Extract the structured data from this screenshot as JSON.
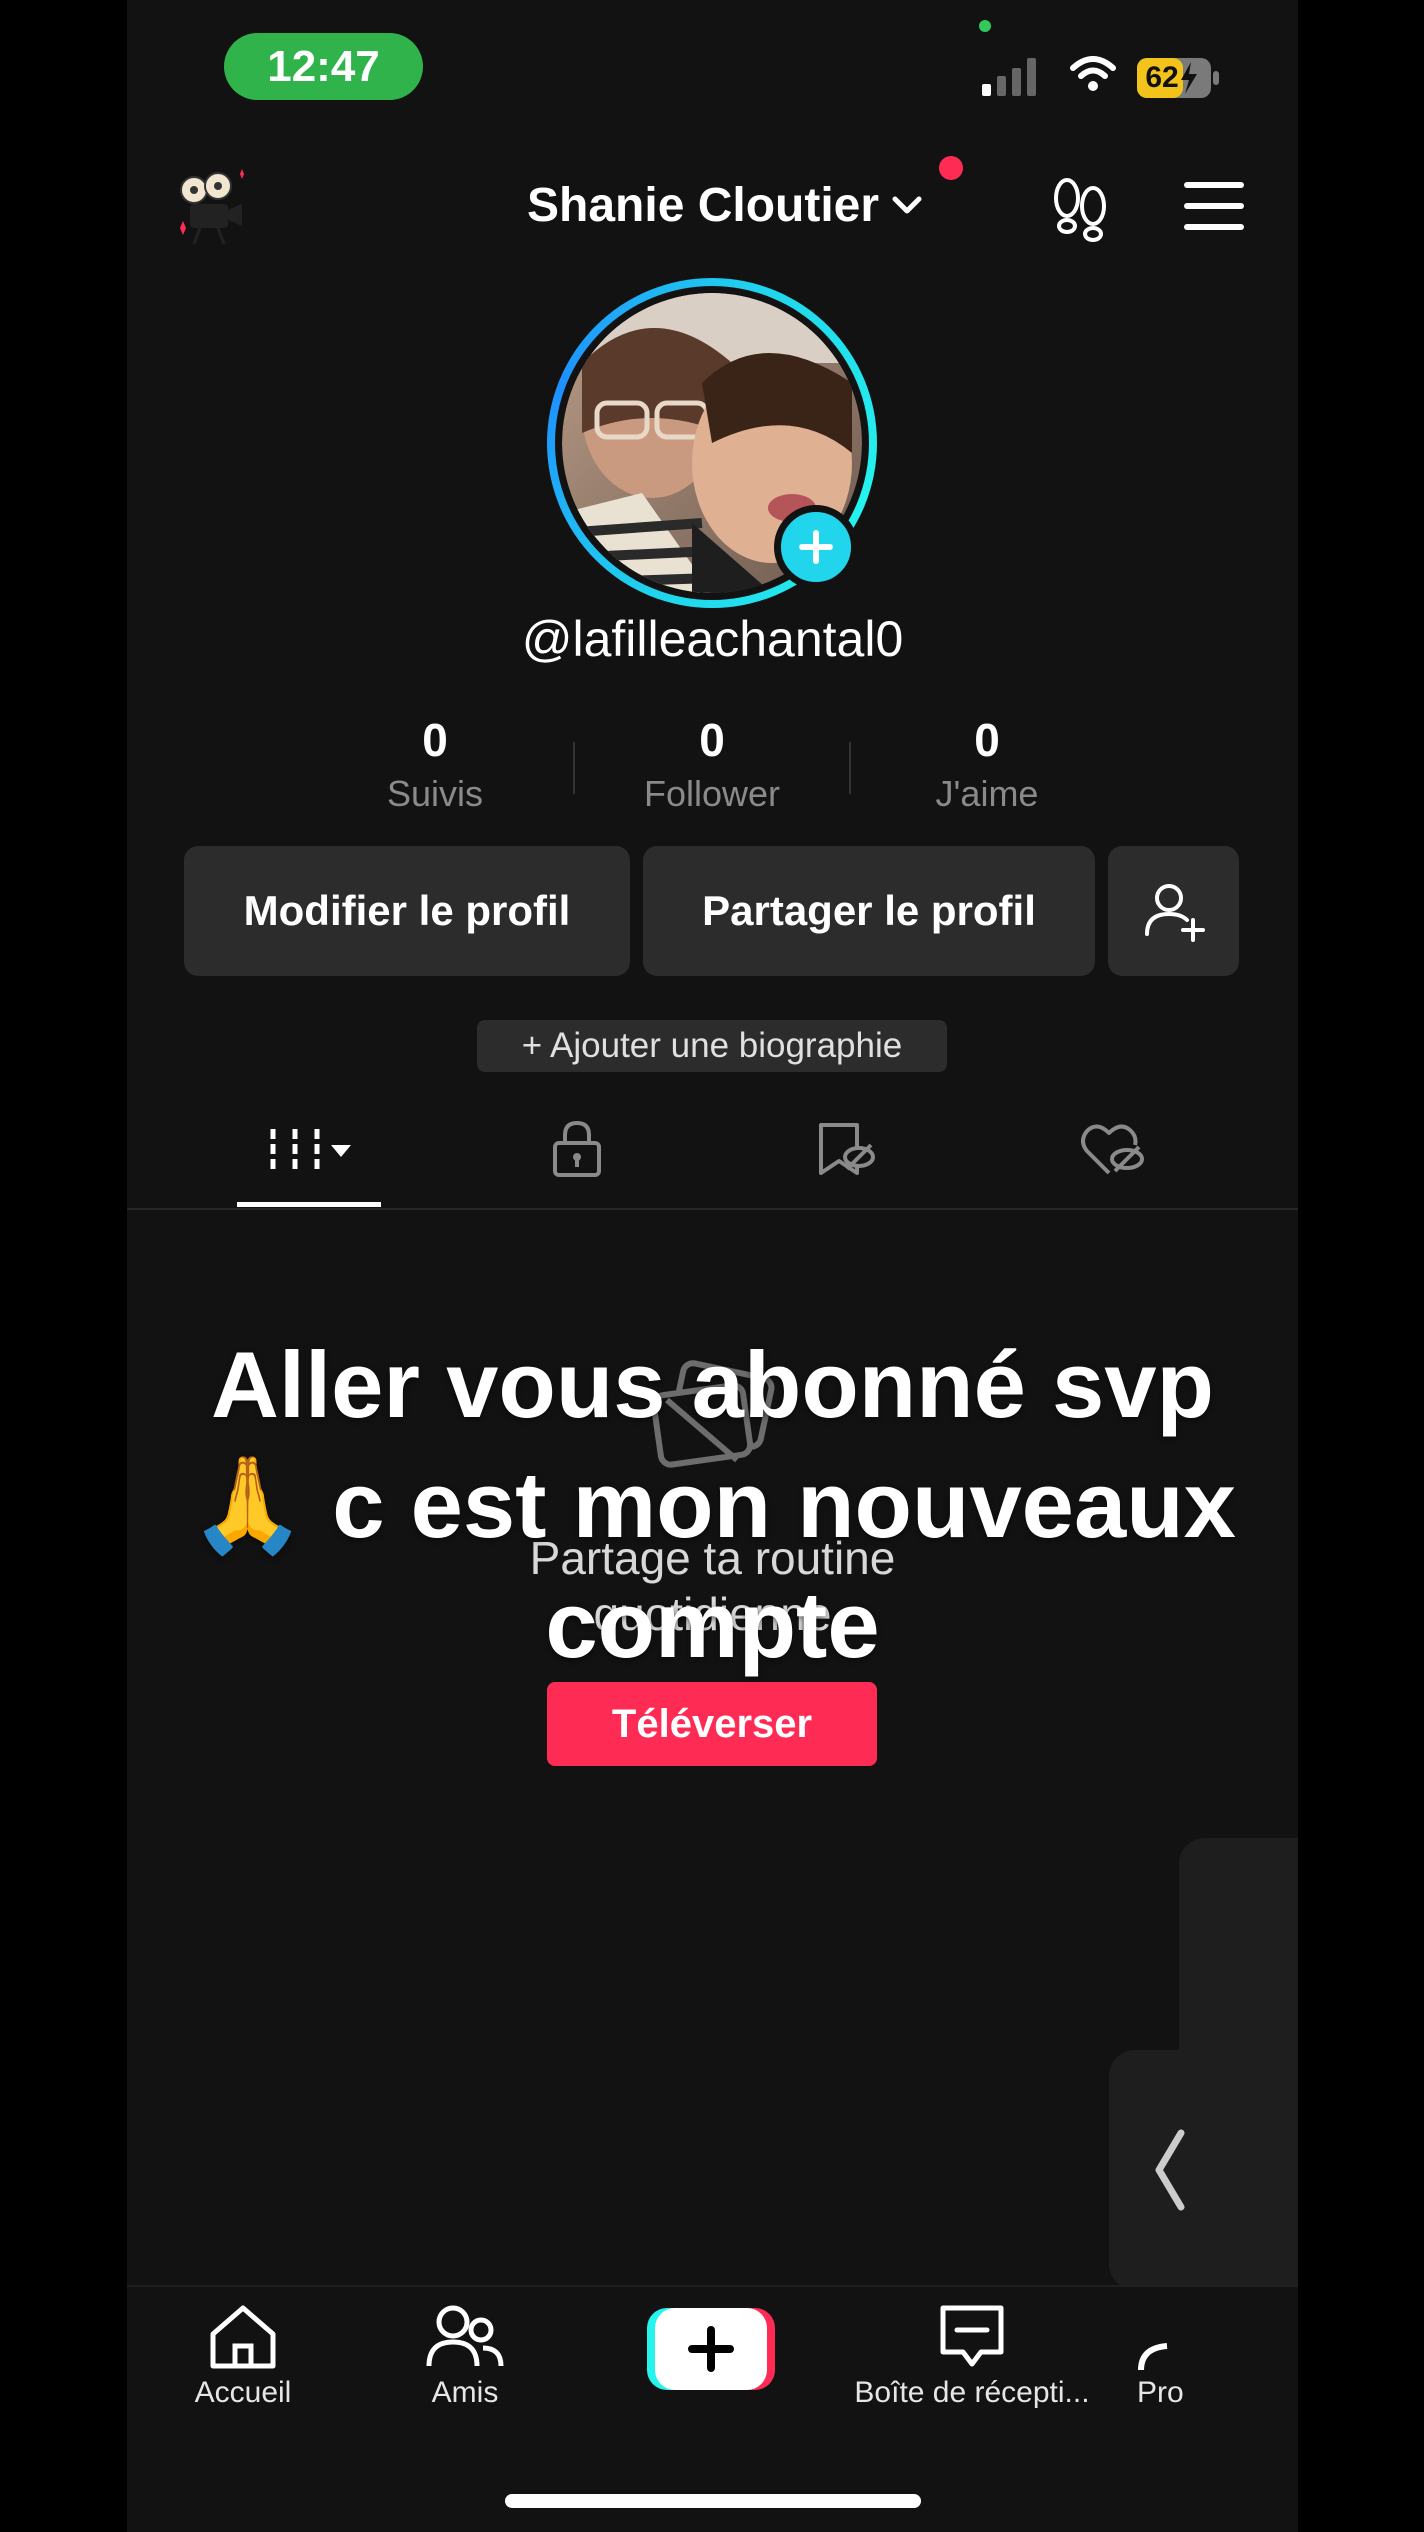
{
  "status_bar": {
    "time": "12:47",
    "battery": "62"
  },
  "header": {
    "profile_name": "Shanie Cloutier"
  },
  "profile": {
    "handle": "@lafilleachantal0",
    "stats": [
      {
        "value": "0",
        "label": "Suivis"
      },
      {
        "value": "0",
        "label": "Follower"
      },
      {
        "value": "0",
        "label": "J'aime"
      }
    ],
    "edit_button": "Modifier le profil",
    "share_button": "Partager le profil",
    "add_bio": "+ Ajouter une biographie"
  },
  "empty_state": {
    "message_line1": "Partage ta routine",
    "message_line2": "quotidienne",
    "upload_button": "Téléverser"
  },
  "overlay_caption": {
    "line1": "Aller vous abonné svp",
    "line2": "🙏 c est mon nouveaux",
    "line3": "compte"
  },
  "bottom_nav": {
    "home": "Accueil",
    "friends": "Amis",
    "inbox": "Boîte de récepti...",
    "profile": "Pro"
  },
  "colors": {
    "accent": "#fe2c55",
    "ring": "#20d5ec",
    "status_green": "#2fb34a"
  }
}
